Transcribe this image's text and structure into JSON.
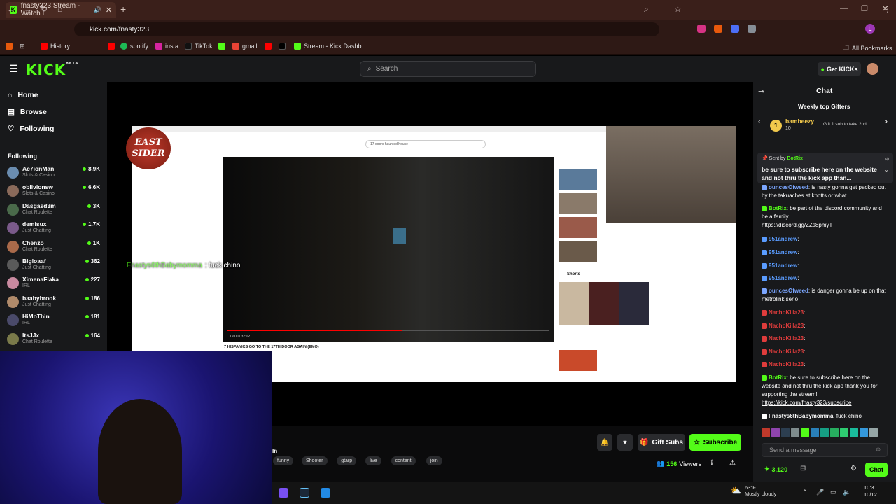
{
  "browser": {
    "tab_title": "fnasty323 Stream - Watch I",
    "url": "kick.com/fnasty323",
    "bookmarks": [
      "History",
      "spotify",
      "insta",
      "TikTok",
      "gmail",
      "Stream - Kick Dashb..."
    ],
    "all_bookmarks": "All Bookmarks",
    "profile_letter": "L"
  },
  "header": {
    "logo": "KICK",
    "logo_sup": "BETA",
    "search_placeholder": "Search",
    "get_kicks": "Get KICKs"
  },
  "sidebar": {
    "nav": [
      {
        "label": "Home",
        "icon": "home-icon"
      },
      {
        "label": "Browse",
        "icon": "compass-icon"
      },
      {
        "label": "Following",
        "icon": "heart-icon"
      }
    ],
    "following_heading": "Following",
    "following": [
      {
        "name": "Ac7ionMan",
        "category": "Slots & Casino",
        "viewers": "8.9K"
      },
      {
        "name": "oblivionsw",
        "category": "Slots & Casino",
        "viewers": "6.6K"
      },
      {
        "name": "Dasgasd3m",
        "category": "Chat Roulette",
        "viewers": "3K"
      },
      {
        "name": "demisux",
        "category": "Just Chatting",
        "viewers": "1.7K"
      },
      {
        "name": "Chenzo",
        "category": "Chat Roulette",
        "viewers": "1K"
      },
      {
        "name": "Bigloaaf",
        "category": "Just Chatting",
        "viewers": "362"
      },
      {
        "name": "XimenaFlaka",
        "category": "IRL",
        "viewers": "227"
      },
      {
        "name": "baabybrook",
        "category": "Just Chatting",
        "viewers": "186"
      },
      {
        "name": "HiMoThin",
        "category": "IRL",
        "viewers": "181"
      },
      {
        "name": "ItsJJx",
        "category": "Chat Roulette",
        "viewers": "164"
      }
    ]
  },
  "video": {
    "overlay_user": "Fnastys6thBabymomma",
    "overlay_msg": ": fuck chino",
    "yt_search": "17 doors haunted house",
    "yt_title": "7 HISPANICS GO TO THE 17TH DOOR AGAIN (EMO)",
    "yt_time": "19:00 / 37:02",
    "yt_shorts": "Shorts",
    "logo_text": "EAST SIDER"
  },
  "stream_info": {
    "title_tail": "In",
    "tags": [
      "funny",
      "Shooter",
      "gtarp",
      "live",
      "content",
      "join"
    ],
    "gift_subs": "Gift Subs",
    "subscribe": "Subscribe",
    "viewers": "156",
    "viewers_label": "Viewers"
  },
  "chat": {
    "title": "Chat",
    "weekly_top": "Weekly top Gifters",
    "top_gifter": {
      "name": "bambeezy",
      "count": "10",
      "rank": "1",
      "cta": "Gift 1 sub to take 2nd"
    },
    "pinned": {
      "sent_by": "Sent by",
      "bot": "BotRix",
      "text": "be sure to subscribe here on the website and not thru the kick app than..."
    },
    "messages": [
      {
        "user": "ouncesOfweed",
        "text": ": is nasty gonna get packed out by the takuaches at knotts or what",
        "color": "#7ba6ff"
      },
      {
        "user": "BotRix",
        "text": ": be part of the discord community and be a family",
        "link": "https://discord.gg/ZZs8pmyT",
        "color": "#53fc18"
      },
      {
        "user": "951andrew",
        "text": ":",
        "color": "#5a9cff"
      },
      {
        "user": "951andrew",
        "text": ":",
        "color": "#5a9cff"
      },
      {
        "user": "951andrew",
        "text": ":",
        "color": "#5a9cff"
      },
      {
        "user": "951andrew",
        "text": ":",
        "color": "#5a9cff"
      },
      {
        "user": "ouncesOfweed",
        "text": ": is danger gonna be up on that metrolink serio",
        "color": "#7ba6ff"
      },
      {
        "user": "NachoKilla23",
        "text": ":",
        "color": "#e03c3c"
      },
      {
        "user": "NachoKilla23",
        "text": ":",
        "color": "#e03c3c"
      },
      {
        "user": "NachoKilla23",
        "text": ":",
        "color": "#e03c3c"
      },
      {
        "user": "NachoKilla23",
        "text": ":",
        "color": "#e03c3c"
      },
      {
        "user": "NachoKilla23",
        "text": ":",
        "color": "#e03c3c"
      },
      {
        "user": "BotRix",
        "text": ": be sure to subscribe here on the website and not thru the kick app thank you for supporting the stream!",
        "link": "https://kick.com/fnasty323/subscribe",
        "color": "#53fc18"
      },
      {
        "user": "Fnastys6thBabymomma",
        "text": ": fuck chino",
        "color": "#ffffff"
      }
    ],
    "send_placeholder": "Send a message",
    "points": "3,120",
    "chat_button": "Chat"
  },
  "taskbar": {
    "temp": "63°F",
    "weather": "Mostly cloudy",
    "time": "10:3",
    "date": "10/12"
  },
  "colors": {
    "accent": "#53fc18",
    "bg": "#18191b",
    "chrome": "#3a1f1a"
  }
}
